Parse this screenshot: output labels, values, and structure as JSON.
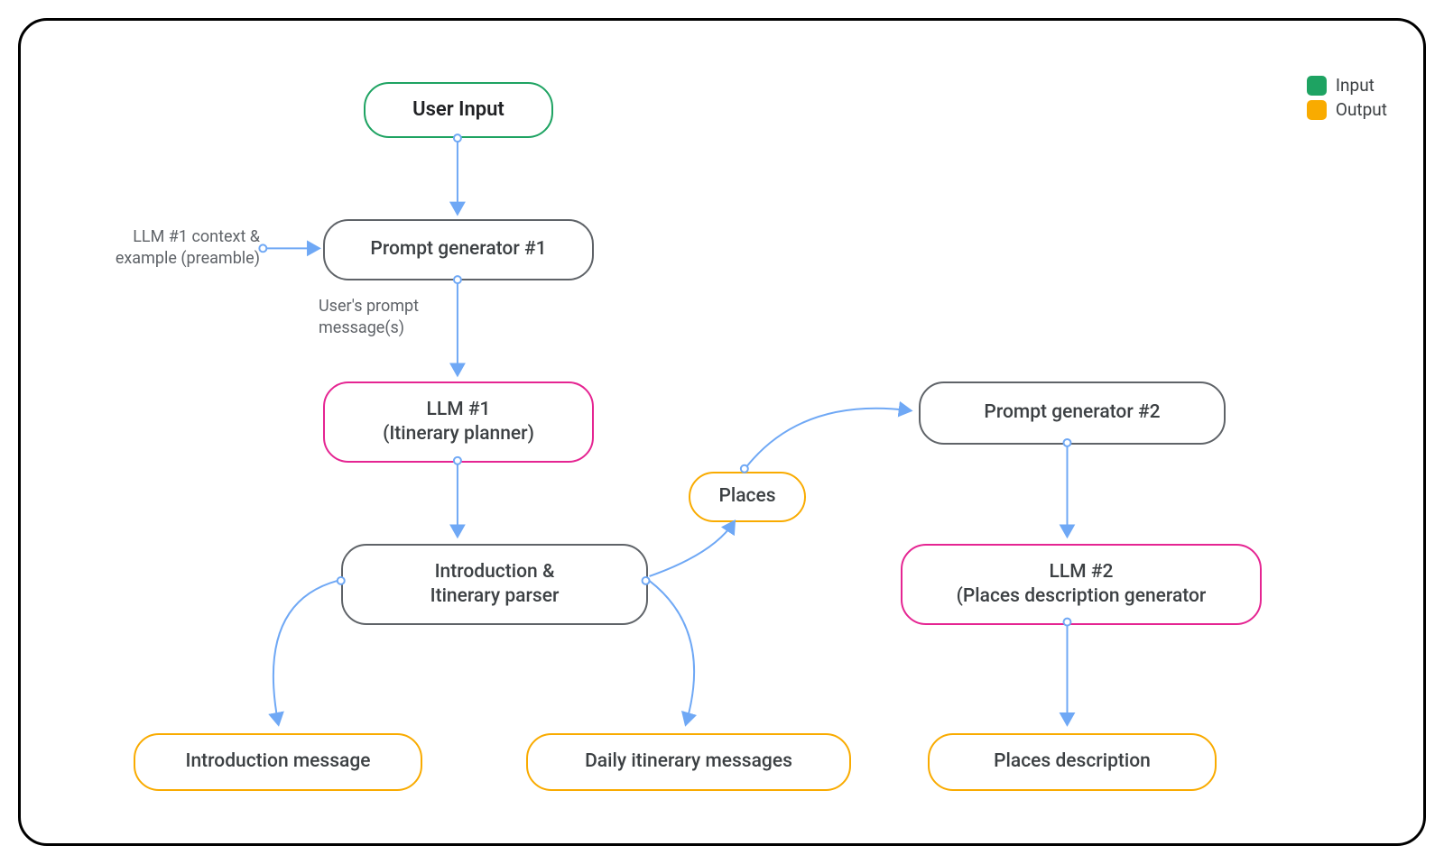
{
  "nodes": {
    "user_input": "User Input",
    "prompt_gen_1": "Prompt generator #1",
    "llm1_line1": "LLM #1",
    "llm1_line2": "(Itinerary planner)",
    "parser_line1": "Introduction &",
    "parser_line2": "Itinerary parser",
    "intro_msg": "Introduction message",
    "daily_msg": "Daily itinerary messages",
    "places": "Places",
    "prompt_gen_2": "Prompt generator #2",
    "llm2_line1": "LLM #2",
    "llm2_line2": "(Places description generator",
    "places_desc": "Places description"
  },
  "labels": {
    "preamble_line1": "LLM #1 context &",
    "preamble_line2": "example (preamble)",
    "user_prompt_line1": "User's prompt",
    "user_prompt_line2": "message(s)"
  },
  "legend": {
    "input": "Input",
    "output": "Output"
  },
  "colors": {
    "green": "#1EA362",
    "orange": "#F9AB00",
    "magenta": "#E52592",
    "gray": "#5f6368",
    "arrow": "#6FA8F5"
  }
}
